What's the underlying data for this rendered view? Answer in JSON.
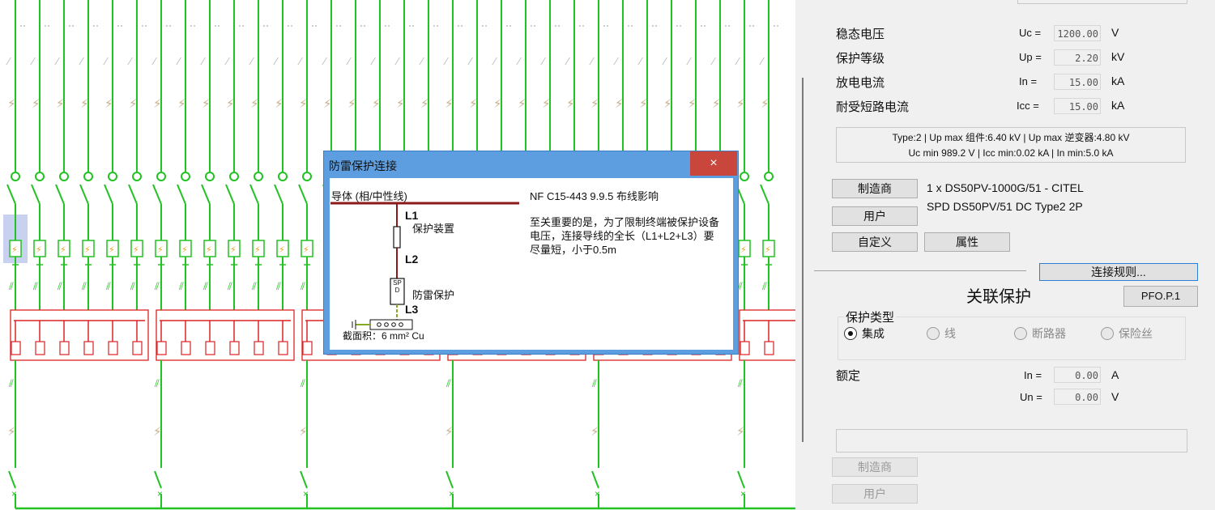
{
  "schematic": {
    "colors": {
      "wire": "#22c222",
      "bus": "#dd2222",
      "breaker_red": "#e03030",
      "surge": "#c8b090"
    }
  },
  "dialog": {
    "title": "防雷保护连接",
    "close_icon": "×",
    "diagram": {
      "conductor_label": "导体 (相/中性线)",
      "l1": "L1",
      "protection_device": "保护装置",
      "l2": "L2",
      "spd_letters": "SPD",
      "lightning_protection": "防雷保护",
      "l3": "L3",
      "cross_section": "截面积：6 mm² Cu"
    },
    "standard_ref": "NF C15-443 9.9.5 布线影响",
    "description": "至关重要的是，为了限制终端被保护设备电压，连接导线的全长（L1+L2+L3）要尽量短，小于0.5m"
  },
  "panel": {
    "rows": [
      {
        "label": "稳态电压",
        "symbol": "Uc =",
        "value": "1200.00",
        "unit": "V"
      },
      {
        "label": "保护等级",
        "symbol": "Up =",
        "value": "2.20",
        "unit": "kV"
      },
      {
        "label": "放电电流",
        "symbol": "In =",
        "value": "15.00",
        "unit": "kA"
      },
      {
        "label": "耐受短路电流",
        "symbol": "Icc =",
        "value": "15.00",
        "unit": "kA"
      }
    ],
    "summary_line1": "Type:2 | Up max 组件:6.40 kV | Up max 逆变器:4.80 kV",
    "summary_line2": "Uc min 989.2 V | Icc min:0.02 kA | In min:5.0 kA",
    "buttons": {
      "manufacturer": "制造商",
      "user": "用户",
      "custom": "自定义",
      "properties": "属性",
      "connection_rules": "连接规则...",
      "pfo": "PFO.P.1"
    },
    "product_line1": "1 x DS50PV-1000G/51 - CITEL",
    "product_line2": "SPD DS50PV/51 DC Type2 2P",
    "associated_protection": {
      "title": "关联保护",
      "type_group": "保护类型",
      "options": [
        {
          "label": "集成",
          "checked": true,
          "enabled": true
        },
        {
          "label": "线",
          "checked": false,
          "enabled": false
        },
        {
          "label": "断路器",
          "checked": false,
          "enabled": false
        },
        {
          "label": "保险丝",
          "checked": false,
          "enabled": false
        }
      ],
      "rated_label": "额定",
      "rated_rows": [
        {
          "symbol": "In =",
          "value": "0.00",
          "unit": "A"
        },
        {
          "symbol": "Un =",
          "value": "0.00",
          "unit": "V"
        }
      ],
      "bottom_manufacturer": "制造商",
      "bottom_user": "用户"
    }
  }
}
